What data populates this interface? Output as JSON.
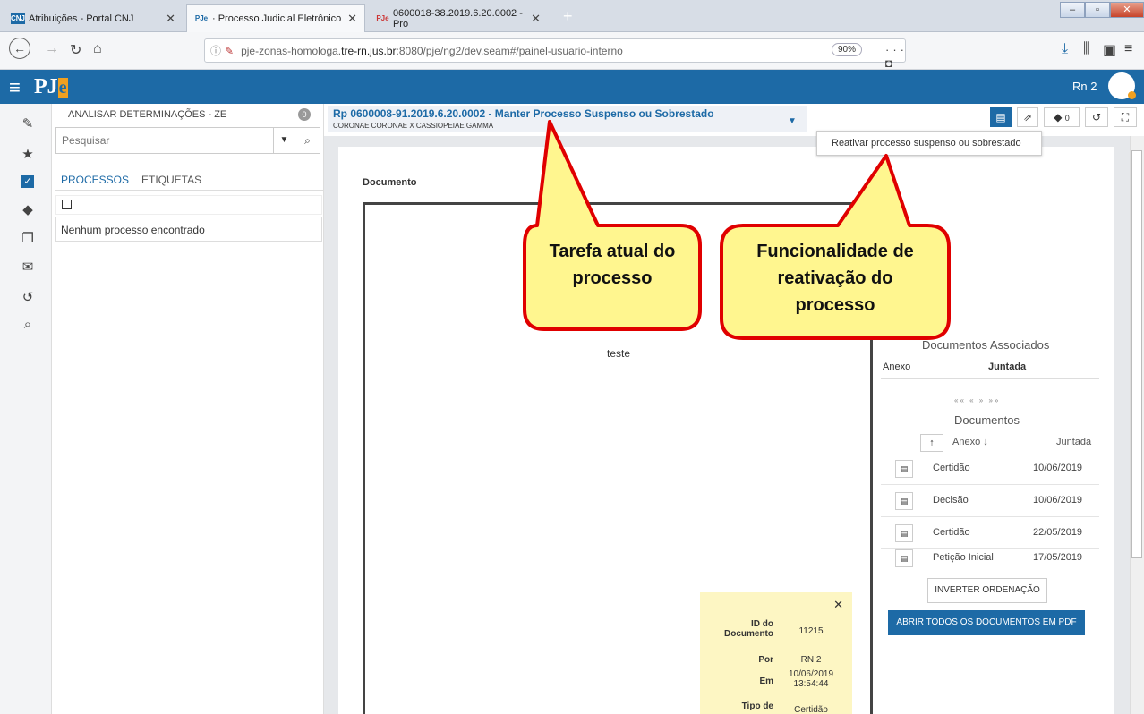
{
  "browser": {
    "tabs": [
      {
        "label": "Atribuições - Portal CNJ",
        "favicon": "CNJ"
      },
      {
        "label": "· Processo Judicial Eletrônico",
        "favicon": "PJe"
      },
      {
        "label": "0600018-38.2019.6.20.0002 - Pro",
        "favicon": "PJe"
      }
    ],
    "url_prefix": "pje-zonas-homologa.",
    "url_host": "tre-rn.jus.br",
    "url_path": ":8080/pje/ng2/dev.seam#/painel-usuario-interno",
    "zoom": "90%"
  },
  "app": {
    "logo_p": "PJ",
    "logo_e": "e",
    "user": "Rn 2"
  },
  "tasks": {
    "title": "ANALISAR DETERMINAÇÕES - ZE",
    "count": "0",
    "search_placeholder": "Pesquisar",
    "tab_processos": "PROCESSOS",
    "tab_etiquetas": "ETIQUETAS",
    "empty_message": "Nenhum processo encontrado"
  },
  "process": {
    "title": "Rp 0600008-91.2019.6.20.0002 - Manter Processo Suspenso ou Sobrestado",
    "parts": "CORONAE CORONAE X CASSIOPEIAE GAMMA",
    "tag_count": "0",
    "tooltip": "Reativar processo suspenso ou sobrestado"
  },
  "document": {
    "label": "Documento",
    "body_text": "teste"
  },
  "associated": {
    "title": "Documentos Associados",
    "col_anexo": "Anexo",
    "col_juntada": "Juntada",
    "pager": "«« « » »»",
    "docs_title": "Documentos",
    "docs_col_anexo": "Anexo",
    "docs_col_juntada": "Juntada",
    "rows": [
      {
        "name": "Certidão",
        "date": "10/06/2019"
      },
      {
        "name": "Decisão",
        "date": "10/06/2019"
      },
      {
        "name": "Certidão",
        "date": "22/05/2019"
      },
      {
        "name": "Petição Inicial",
        "date": "17/05/2019"
      }
    ],
    "invert_label": "INVERTER ORDENAÇÃO",
    "pdf_label": "ABRIR TODOS OS DOCUMENTOS EM PDF"
  },
  "info_box": {
    "id_label": "ID do Documento",
    "id_value": "11215",
    "por_label": "Por",
    "por_value": "RN 2",
    "em_label": "Em",
    "em_value": "10/06/2019 13:54:44",
    "tipo_label": "Tipo de",
    "tipo_value": "Certidão"
  },
  "callouts": {
    "left": "Tarefa atual do processo",
    "right": "Funcionalidade de reativação do processo"
  },
  "colors": {
    "brand": "#1d6aa6",
    "accent": "#f0a020",
    "callout_fill": "#fff68f",
    "callout_stroke": "#e00000"
  }
}
